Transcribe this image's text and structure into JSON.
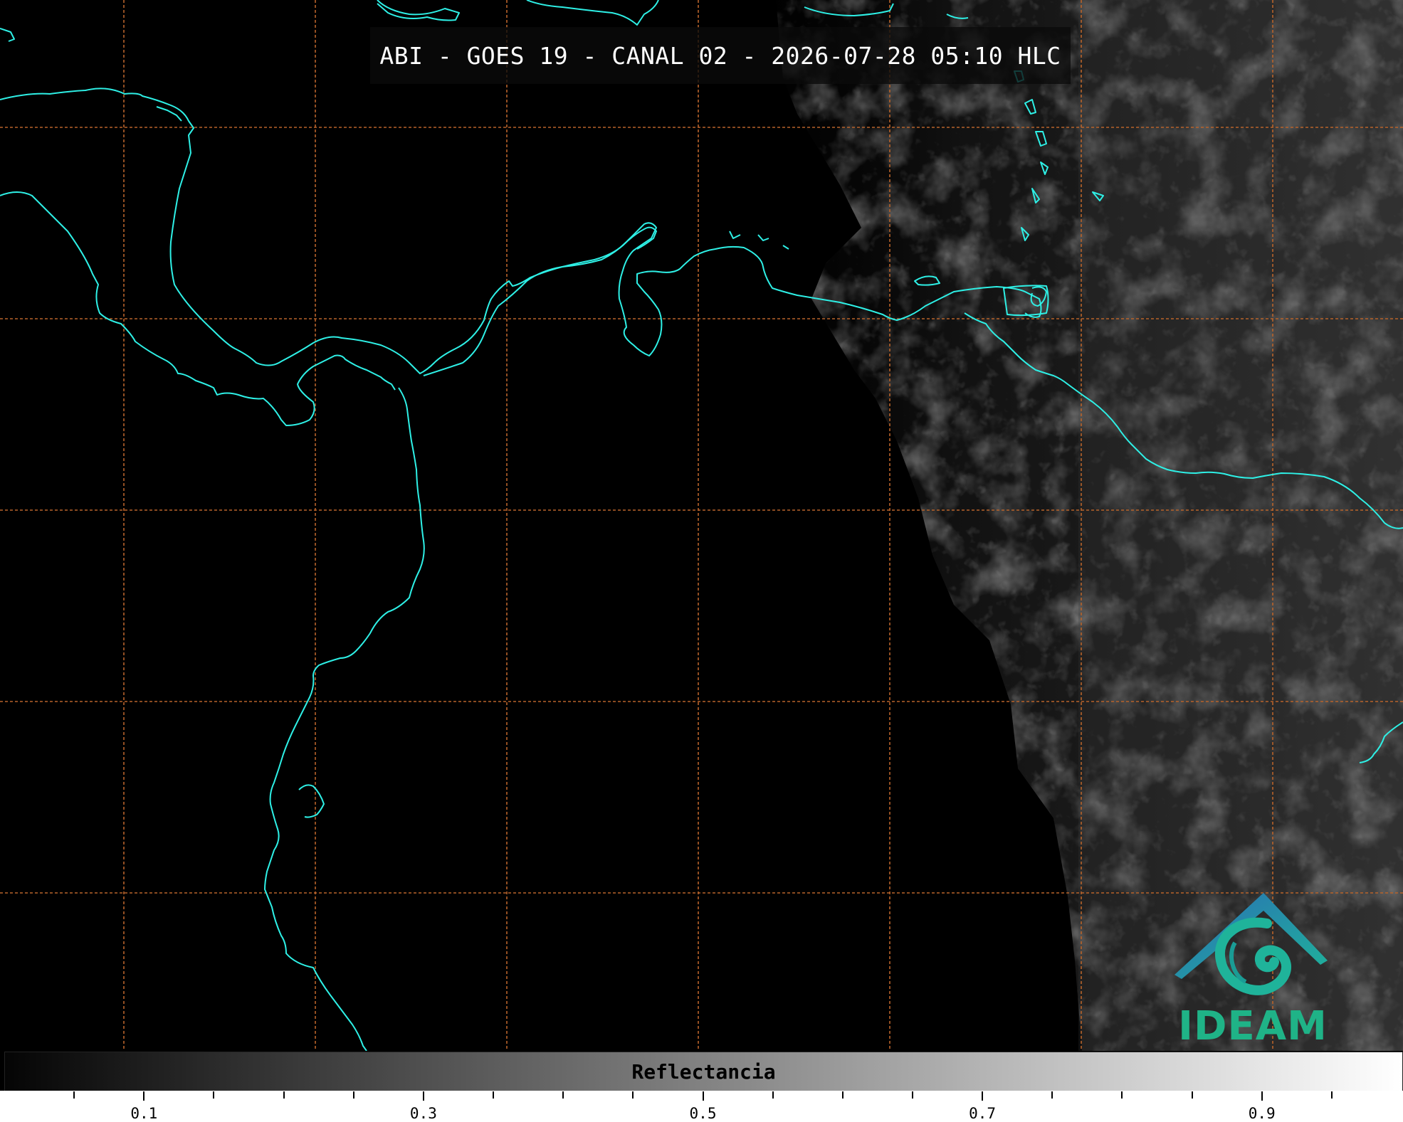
{
  "title": "ABI - GOES 19 - CANAL 02 - 2026-07-28 05:10 HLC",
  "colorbar": {
    "label": "Reflectancia",
    "range": [
      0.0,
      1.0
    ],
    "tick_labels": [
      "0.1",
      "0.3",
      "0.5",
      "0.7",
      "0.9"
    ],
    "gradient_colors": [
      "#050505",
      "#ffffff"
    ]
  },
  "logo": {
    "text": "IDEAM",
    "colors": {
      "roof": "#2a7ab0",
      "spiral": "#1fb39a",
      "text": "#1fb387"
    }
  },
  "colors": {
    "coastline": "#2ef0e6",
    "gridline": "#b8632a",
    "background": "#000000"
  },
  "icons": [
    "ideam-logo-icon"
  ]
}
